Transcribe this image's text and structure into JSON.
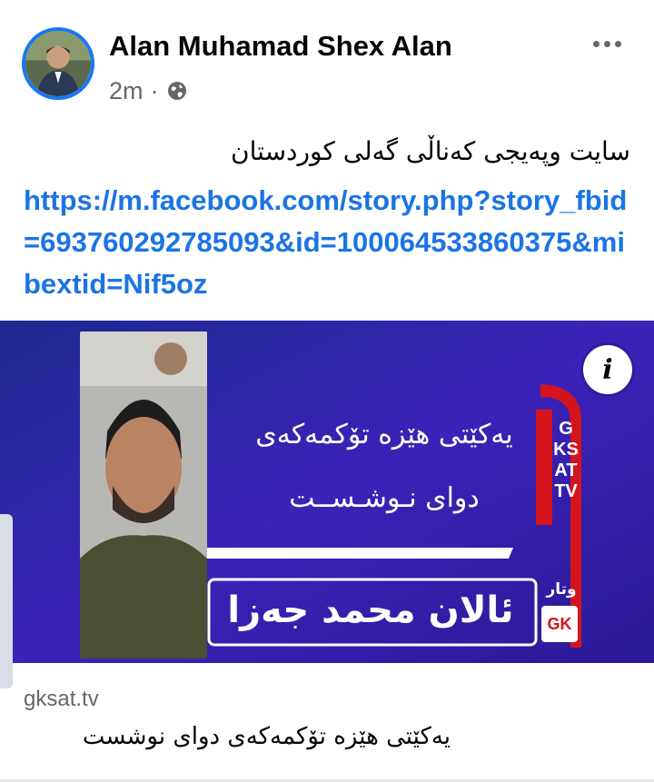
{
  "post": {
    "author": "Alan Muhamad Shex Alan",
    "time": "2m",
    "separator": "·",
    "privacy_icon": "globe-icon",
    "more_icon": "more-options-icon",
    "text": "سایت وپەیجی کەناڵی گەلی کوردستان",
    "link": "https://m.facebook.com/story.php?story_fbid=693760292785093&id=100064533860375&mibextid=Nif5oz"
  },
  "card": {
    "headline_line1": "یەکێتی هێزە تۆکمەکەی",
    "headline_line2": "دواى نـوشـســت",
    "author_name": "ئالان محمد جەزا",
    "channel_vertical": "GKSAT TV",
    "channel_label": "وتار",
    "channel_logo": "GK",
    "info_label": "i",
    "domain": "gksat.tv",
    "title": "یەکێتی هێزە تۆکمەکەی دواى نوشست"
  },
  "colors": {
    "link": "#1b74e4",
    "avatar_ring": "#1877f2",
    "card_bg": "#2b1fa8",
    "channel_red": "#d4141c"
  }
}
